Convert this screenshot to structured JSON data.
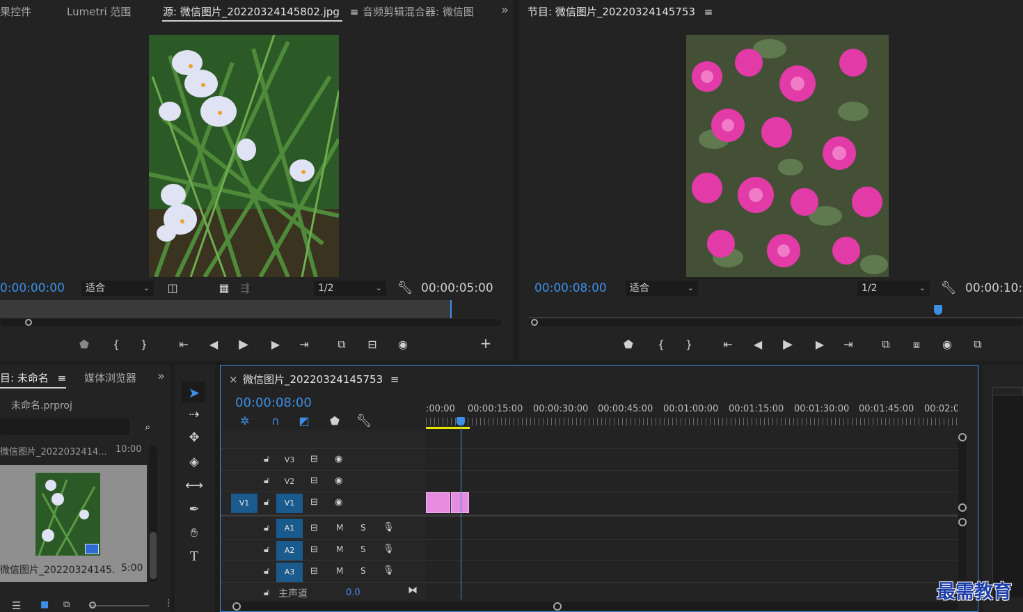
{
  "source_panel": {
    "tabs": [
      "果控件",
      "Lumetri 范围",
      "源: 微信图片_20220324145802.jpg",
      "音频剪辑混合器: 微信图"
    ],
    "menu_glyph": "≡",
    "overflow_glyph": "»",
    "timecode": "0:00:00:00",
    "fit_label": "适合",
    "resolution": "1/2",
    "duration": "00:00:05:00"
  },
  "program_panel": {
    "title": "节目: 微信图片_20220324145753",
    "menu_glyph": "≡",
    "timecode": "00:00:08:00",
    "fit_label": "适合",
    "resolution": "1/2",
    "duration": "00:00:10:0"
  },
  "project_panel": {
    "tabs": [
      "目: 未命名",
      "媒体浏览器"
    ],
    "menu_glyph": "≡",
    "overflow_glyph": "»",
    "project_file": "未命名.prproj",
    "item_top_name": "微信图片_2022032414...",
    "item_top_duration": "10:00",
    "item_name": "微信图片_20220324145...",
    "item_duration": "5:00"
  },
  "timeline_panel": {
    "close_glyph": "×",
    "sequence_name": "微信图片_20220324145753",
    "menu_glyph": "≡",
    "timecode": "00:00:08:00",
    "ruler": [
      ":00:00",
      "00:00:15:00",
      "00:00:30:00",
      "00:00:45:00",
      "00:01:00:00",
      "00:01:15:00",
      "00:01:30:00",
      "00:01:45:00",
      "00:02:0"
    ],
    "video_tracks": [
      "V3",
      "V2",
      "V1"
    ],
    "source_patch_video": "V1",
    "audio_tracks": [
      "A1",
      "A2",
      "A3"
    ],
    "mute_label": "M",
    "solo_label": "S",
    "master_label": "主声道",
    "master_value": "0.0"
  },
  "watermark": "最需教育",
  "colors": {
    "accent": "#3d8fe6",
    "clip": "#e58be0",
    "track_selected": "#1a5a8c",
    "work_area": "#e6e600"
  }
}
